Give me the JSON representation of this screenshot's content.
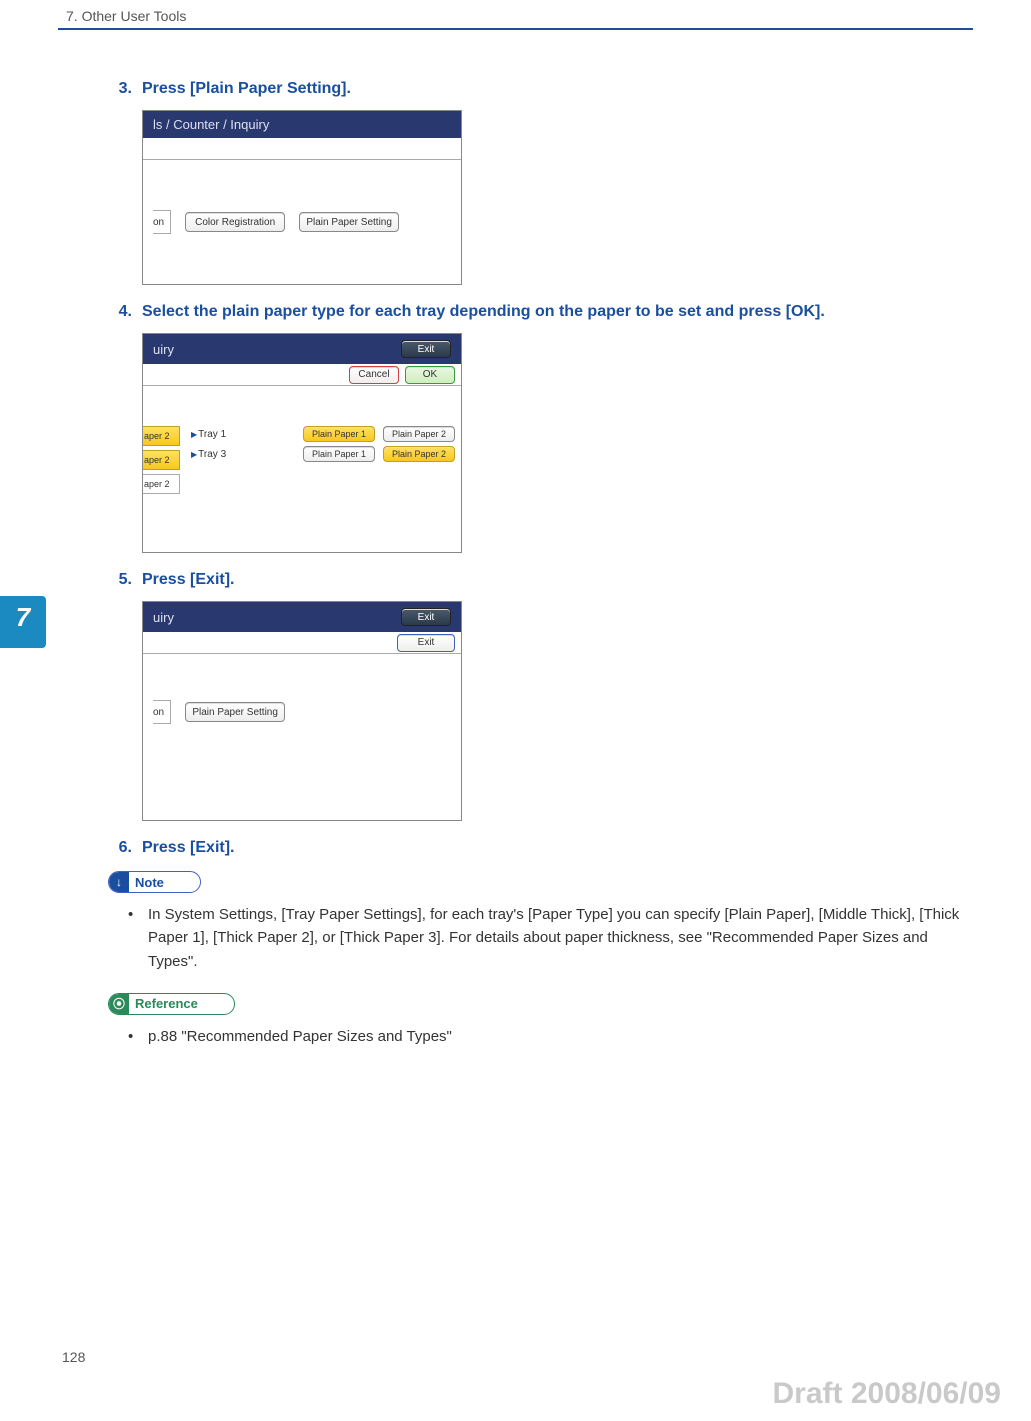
{
  "header": {
    "chapter": "7. Other User Tools"
  },
  "sideTab": "7",
  "steps": {
    "s3": {
      "num": "3.",
      "text": "Press [Plain Paper Setting]."
    },
    "s4": {
      "num": "4.",
      "text": "Select the plain paper type for each tray depending on the paper to be set and press [OK]."
    },
    "s5": {
      "num": "5.",
      "text": "Press [Exit]."
    },
    "s6": {
      "num": "6.",
      "text": "Press [Exit]."
    }
  },
  "shot1": {
    "title": "ls / Counter / Inquiry",
    "onFrag": "on",
    "btnColor": "Color Registration",
    "btnPlain": "Plain Paper Setting"
  },
  "shot2": {
    "title": "uiry",
    "exitTop": "Exit",
    "cancel": "Cancel",
    "ok": "OK",
    "leftTab": "aper 2",
    "tray1": "Tray 1",
    "tray3": "Tray 3",
    "pp1": "Plain Paper 1",
    "pp2": "Plain Paper 2"
  },
  "shot3": {
    "title": "uiry",
    "exitTop": "Exit",
    "exit": "Exit",
    "onFrag": "on",
    "btnPlain": "Plain Paper Setting"
  },
  "note": {
    "label": "Note",
    "bullet": "In System Settings, [Tray Paper Settings], for each tray's [Paper Type] you can specify [Plain Paper], [Middle Thick], [Thick Paper 1], [Thick Paper 2], or [Thick Paper 3]. For details about paper thickness, see \"Recommended Paper Sizes and Types\"."
  },
  "reference": {
    "label": "Reference",
    "bullet": "p.88 \"Recommended Paper Sizes and Types\""
  },
  "pageNumber": "128",
  "watermark": "Draft 2008/06/09"
}
